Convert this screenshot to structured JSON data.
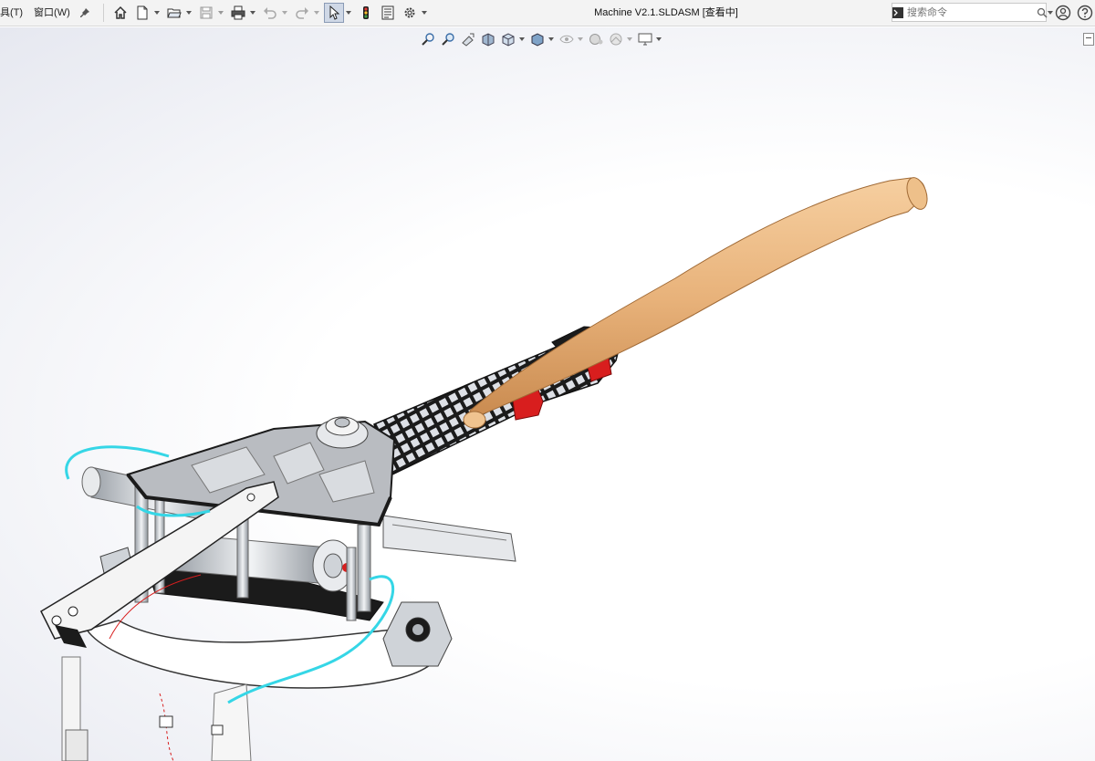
{
  "window": {
    "title": "Machine V2.1.SLDASM [查看中]"
  },
  "menu": {
    "items": [
      {
        "label": "具(T)"
      },
      {
        "label": "窗口(W)"
      }
    ]
  },
  "toolbar": {
    "icons": [
      "home-icon",
      "new-document-icon",
      "open-folder-icon",
      "save-icon",
      "print-icon",
      "undo-icon",
      "redo-icon",
      "select-arrow-icon",
      "rebuild-traffic-light-icon",
      "file-properties-icon",
      "options-gear-icon"
    ]
  },
  "search": {
    "placeholder": "搜索命令"
  },
  "heads_up": {
    "icons": [
      "zoom-to-fit-icon",
      "zoom-area-icon",
      "previous-view-icon",
      "section-view-icon",
      "view-orientation-icon",
      "display-style-icon",
      "hide-show-items-icon",
      "edit-appearance-icon",
      "apply-scene-icon",
      "view-settings-icon"
    ]
  },
  "colors": {
    "accent_select": "#cfd8e6",
    "bat_wood": "#e8b27a",
    "frame_black": "#1b1b1b",
    "cable_cyan": "#35d6e6",
    "clamp_red": "#d81e1e",
    "aluminum": "#d9dde2"
  }
}
